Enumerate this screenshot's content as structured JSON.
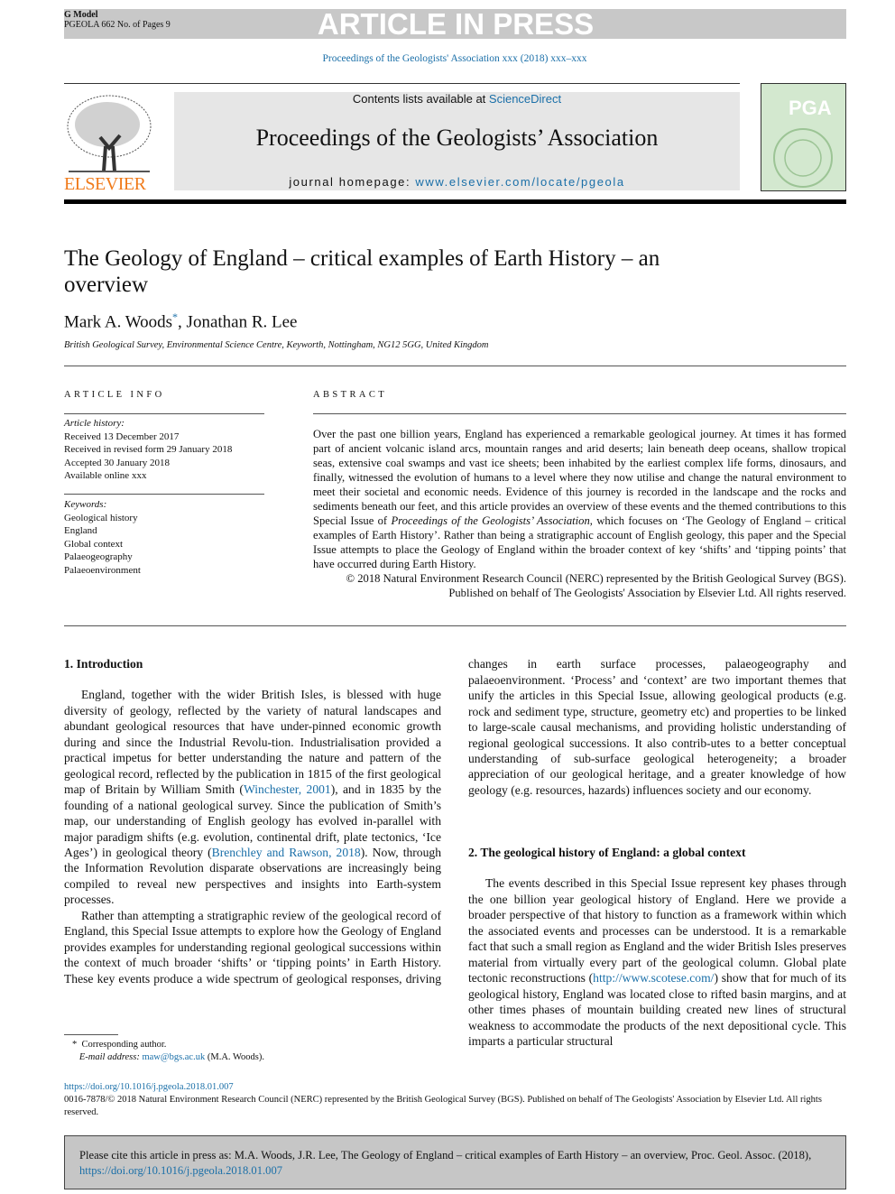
{
  "banner": {
    "g_model": "G Model",
    "ref": "PGEOLA 662 No. of Pages 9",
    "article_in_press": "ARTICLE IN PRESS"
  },
  "journal_ref": "Proceedings of the Geologists' Association xxx (2018) xxx–xxx",
  "header": {
    "contents_prefix": "Contents lists available at ",
    "sciencedirect": "ScienceDirect",
    "journal_title": "Proceedings of the Geologists’ Association",
    "homepage_prefix": "journal homepage: ",
    "homepage_url": "www.elsevier.com/locate/pgeola",
    "publisher_logo": "ELSEVIER",
    "cover_text": "PGA"
  },
  "article": {
    "title": "The Geology of England – critical examples of Earth History – an overview",
    "author1": "Mark A. Woods",
    "author_mark": "*",
    "author2": ", Jonathan R. Lee",
    "affiliation": "British Geological Survey, Environmental Science Centre, Keyworth, Nottingham, NG12 5GG, United Kingdom"
  },
  "info": {
    "heading": "ARTICLE INFO",
    "history_label": "Article history:",
    "history": [
      "Received 13 December 2017",
      "Received in revised form 29 January 2018",
      "Accepted 30 January 2018",
      "Available online xxx"
    ],
    "keywords_label": "Keywords:",
    "keywords": [
      "Geological history",
      "England",
      "Global context",
      "Palaeogeography",
      "Palaeoenvironment"
    ]
  },
  "abstract": {
    "heading": "ABSTRACT",
    "t1": "Over the past one billion years, England has experienced a remarkable geological journey. At times it has formed part of ancient volcanic island arcs, mountain ranges and arid deserts; lain beneath deep oceans, shallow tropical seas, extensive coal swamps and vast ice sheets; been inhabited by the earliest complex life forms, dinosaurs, and finally, witnessed the evolution of humans to a level where they now utilise and change the natural environment to meet their societal and economic needs. Evidence of this journey is recorded in the landscape and the rocks and sediments beneath our feet, and this article provides an overview of these events and the themed contributions to this Special Issue of ",
    "t2": "Proceedings of the Geologists’ Association",
    "t3": ", which focuses on ‘The Geology of England – critical examples of Earth History’. Rather than being a stratigraphic account of English geology, this paper and the Special Issue attempts to place the Geology of England within the broader context of key ‘shifts’ and ‘tipping points’ that have occurred during Earth History.",
    "copyright": "© 2018 Natural Environment Research Council (NERC) represented by the British Geological Survey (BGS). Published on behalf of The Geologists' Association by Elsevier Ltd. All rights reserved."
  },
  "body": {
    "s1_heading": "1. Introduction",
    "p1a": "England, together with the wider British Isles, is blessed with huge diversity of geology, reflected by the variety of natural landscapes and abundant geological resources that have under-pinned economic growth during and since the Industrial Revolu-tion. Industrialisation provided a practical impetus for better understanding the nature and pattern of the geological record, reflected by the publication in 1815 of the first geological map of Britain by William Smith (",
    "p1_link1": "Winchester, 2001",
    "p1b": "), and in 1835 by the founding of a national geological survey. Since the publication of Smith’s map, our understanding of English geology has evolved in-parallel with major paradigm shifts (e.g. evolution, continental drift, plate tectonics, ‘Ice Ages’) in geological theory (",
    "p1_link2": "Brenchley and Rawson, 2018",
    "p1c": "). Now, through the Information Revolution disparate observations are increasingly being compiled to reveal new perspectives and insights into Earth-system processes.",
    "p2": "Rather than attempting a stratigraphic review of the geological record of England, this Special Issue attempts to explore how the Geology of England provides examples for understanding regional geological successions within the context of much broader ‘shifts’ or ‘tipping points’ in Earth History. These key events produce a wide spectrum of geological responses, driving changes in earth surface processes, palaeogeography and palaeoenvironment. ‘Process’ and ‘context’ are two important themes that unify the articles in this Special Issue, allowing geological products (e.g. rock and sediment type, structure, geometry etc) and properties to be linked to large-scale causal mechanisms, and providing holistic understanding of regional geological successions. It also contrib-utes to a better conceptual understanding of sub-surface geological heterogeneity; a broader appreciation of our geological heritage, and a greater knowledge of how geology (e.g. resources, hazards) influences society and our economy.",
    "s2_heading": "2. The geological history of England: a global context",
    "p3a": "The events described in this Special Issue represent key phases through the one billion year geological history of England. Here we provide a broader perspective of that history to function as a framework within which the associated events and processes can be understood. It is a remarkable fact that such a small region as England and the wider British Isles preserves material from virtually every part of the geological column. Global plate tectonic reconstructions (",
    "p3_link": "http://www.scotese.com/",
    "p3b": ") show that for much of its geological history, England was located close to rifted basin margins, and at other times phases of mountain building created new lines of structural weakness to accommodate the products of the next depositional cycle. This imparts a particular structural"
  },
  "footnote": {
    "mark": "*",
    "corresponding": "Corresponding author.",
    "email_label": "E-mail address: ",
    "email": "maw@bgs.ac.uk",
    "email_name": " (M.A. Woods)."
  },
  "doi": "https://doi.org/10.1016/j.pgeola.2018.01.007",
  "issn_line": "0016-7878/© 2018 Natural Environment Research Council (NERC) represented by the British Geological Survey (BGS). Published on behalf of The Geologists' Association by Elsevier Ltd. All rights reserved.",
  "cite": {
    "text": "Please cite this article in press as: M.A. Woods, J.R. Lee, The Geology of England – critical examples of Earth History – an overview, Proc. Geol. Assoc. (2018), ",
    "doi": "https://doi.org/10.1016/j.pgeola.2018.01.007"
  },
  "colors": {
    "link": "#1a6fa8",
    "elsevier_orange": "#f07a1a",
    "banner_gray": "#c8c8c8"
  }
}
